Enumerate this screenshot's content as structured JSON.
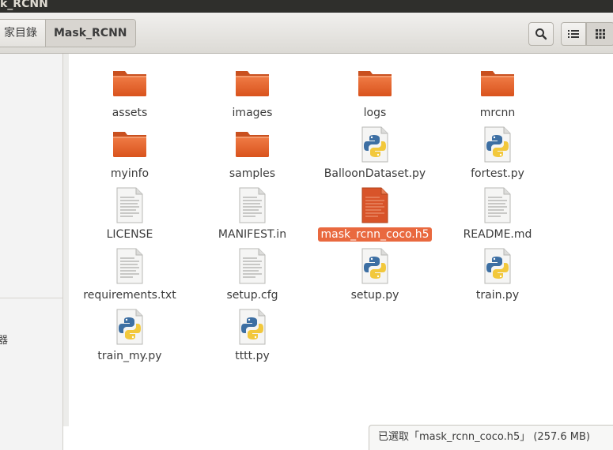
{
  "window": {
    "title": "k_RCNN"
  },
  "breadcrumb": {
    "home_label": "家目錄",
    "current_label": "Mask_RCNN"
  },
  "sidebar": {
    "partial_label": "器"
  },
  "files": [
    {
      "name": "assets",
      "type": "folder"
    },
    {
      "name": "images",
      "type": "folder"
    },
    {
      "name": "logs",
      "type": "folder"
    },
    {
      "name": "mrcnn",
      "type": "folder"
    },
    {
      "name": "myinfo",
      "type": "folder"
    },
    {
      "name": "samples",
      "type": "folder"
    },
    {
      "name": "BalloonDataset.py",
      "type": "python"
    },
    {
      "name": "fortest.py",
      "type": "python"
    },
    {
      "name": "LICENSE",
      "type": "text"
    },
    {
      "name": "MANIFEST.in",
      "type": "text"
    },
    {
      "name": "mask_rcnn_coco.h5",
      "type": "binary",
      "selected": true
    },
    {
      "name": "README.md",
      "type": "text"
    },
    {
      "name": "requirements.txt",
      "type": "text"
    },
    {
      "name": "setup.cfg",
      "type": "text"
    },
    {
      "name": "setup.py",
      "type": "python"
    },
    {
      "name": "train.py",
      "type": "python"
    },
    {
      "name": "train_my.py",
      "type": "python"
    },
    {
      "name": "tttt.py",
      "type": "python"
    }
  ],
  "statusbar": {
    "text": "已選取「mask_rcnn_coco.h5」 (257.6 MB)"
  },
  "colors": {
    "accent": "#e9693f",
    "folder": "#e6642c",
    "titlebar": "#2f2f2c"
  }
}
